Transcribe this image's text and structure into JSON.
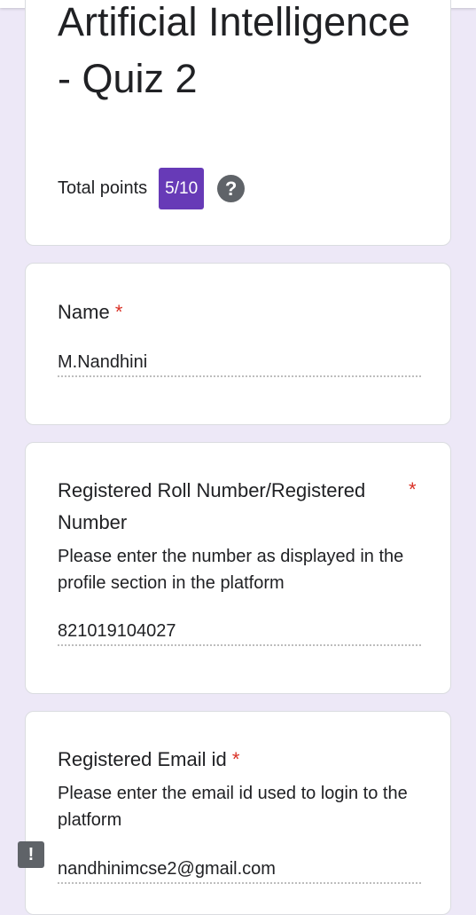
{
  "form": {
    "title": "Artificial Intelligence - Quiz 2",
    "total_points_label": "Total points",
    "score": "5/10"
  },
  "questions": [
    {
      "label": "Name",
      "required_marker": "*",
      "answer": "M.Nandhini"
    },
    {
      "label": "Registered Roll Number/Registered Number",
      "required_marker": "*",
      "description": "Please enter the number as displayed in the profile section in the platform",
      "answer": "821019104027"
    },
    {
      "label": "Registered Email id",
      "required_marker": "*",
      "description": "Please enter the email id used to login to the platform",
      "answer": "nandhinimcse2@gmail.com"
    }
  ],
  "icons": {
    "help": "help-icon",
    "feedback": "report-feedback-icon"
  },
  "colors": {
    "accent": "#673ab7",
    "background": "#ede8f7",
    "required": "#d93025"
  }
}
